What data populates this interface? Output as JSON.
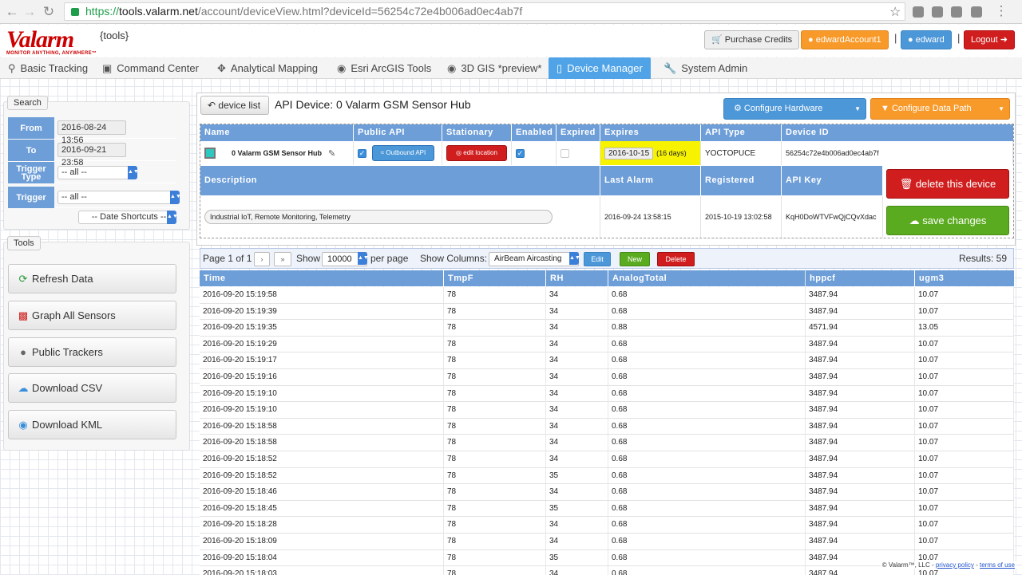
{
  "browser": {
    "url_scheme": "https://",
    "url_host": "tools.valarm.net",
    "url_path": "/account/deviceView.html?deviceId=56254c72e4b006ad0ec4ab7f"
  },
  "header": {
    "logo_text_red": "V",
    "logo_text_black": "alarm",
    "logo_tagline": "MONITOR ANYTHING, ANYWHERE™",
    "tools_label": "{tools}",
    "purchase_credits": "Purchase Credits",
    "account": "edwardAccount1",
    "user": "edward",
    "logout": "Logout",
    "sep": "|"
  },
  "tabs": [
    {
      "label": "Basic Tracking",
      "icon": "map-pin-icon"
    },
    {
      "label": "Command Center",
      "icon": "monitor-icon"
    },
    {
      "label": "Analytical Mapping",
      "icon": "crosshair-icon"
    },
    {
      "label": "Esri ArcGIS Tools",
      "icon": "globe-icon"
    },
    {
      "label": "3D GIS *preview*",
      "icon": "globe-icon"
    },
    {
      "label": "Device Manager",
      "icon": "tablet-icon"
    },
    {
      "label": "System Admin",
      "icon": "wrench-icon"
    }
  ],
  "search": {
    "legend": "Search",
    "from_label": "From",
    "from_value": "2016-08-24 13:56",
    "to_label": "To",
    "to_value": "2016-09-21 23:58",
    "trigger_type_label": "Trigger Type",
    "trigger_type_value": "-- all --",
    "trigger_label": "Trigger",
    "trigger_value": "-- all --",
    "date_shortcuts": "-- Date Shortcuts --"
  },
  "tools": {
    "legend": "Tools",
    "refresh": "Refresh Data",
    "graph": "Graph All Sensors",
    "trackers": "Public Trackers",
    "csv": "Download CSV",
    "kml": "Download KML"
  },
  "device": {
    "back_label": "device list",
    "title": "API Device: 0 Valarm GSM Sensor Hub",
    "configure_hardware": "Configure Hardware",
    "configure_data_path": "Configure Data Path",
    "headers": [
      "Name",
      "Public API",
      "Stationary",
      "Enabled",
      "Expired",
      "Expires",
      "API Type",
      "Device ID"
    ],
    "name": "0 Valarm GSM Sensor Hub",
    "outbound_api": "Outbound API",
    "edit_location": "edit location",
    "expires_date": "2016-10-15",
    "expires_days": "(16 days)",
    "api_type": "YOCTOPUCE",
    "device_id": "56254c72e4b006ad0ec4ab7f",
    "headers2": [
      "Description",
      "Last Alarm",
      "Registered",
      "API Key"
    ],
    "description": "Industrial IoT, Remote Monitoring, Telemetry",
    "last_alarm": "2016-09-24 13:58:15",
    "registered": "2015-10-19 13:02:58",
    "api_key": "KqH0DoWTVFwQjCQvXdac",
    "delete_label": "delete this device",
    "save_label": "save changes"
  },
  "pager": {
    "page_text": "Page 1 of 1",
    "next": "›",
    "last": "»",
    "show_label": "Show",
    "show_value": "10000",
    "per_page": "per page",
    "show_columns": "Show Columns:",
    "columns_value": "AirBeam Aircasting",
    "edit": "Edit",
    "new": "New",
    "delete": "Delete",
    "results": "Results: 59"
  },
  "grid": {
    "headers": [
      "Time",
      "TmpF",
      "RH",
      "AnalogTotal",
      "hppcf",
      "ugm3"
    ],
    "rows": [
      [
        "2016-09-20 15:19:58",
        "78",
        "34",
        "0.68",
        "3487.94",
        "10.07"
      ],
      [
        "2016-09-20 15:19:39",
        "78",
        "34",
        "0.68",
        "3487.94",
        "10.07"
      ],
      [
        "2016-09-20 15:19:35",
        "78",
        "34",
        "0.88",
        "4571.94",
        "13.05"
      ],
      [
        "2016-09-20 15:19:29",
        "78",
        "34",
        "0.68",
        "3487.94",
        "10.07"
      ],
      [
        "2016-09-20 15:19:17",
        "78",
        "34",
        "0.68",
        "3487.94",
        "10.07"
      ],
      [
        "2016-09-20 15:19:16",
        "78",
        "34",
        "0.68",
        "3487.94",
        "10.07"
      ],
      [
        "2016-09-20 15:19:10",
        "78",
        "34",
        "0.68",
        "3487.94",
        "10.07"
      ],
      [
        "2016-09-20 15:19:10",
        "78",
        "34",
        "0.68",
        "3487.94",
        "10.07"
      ],
      [
        "2016-09-20 15:18:58",
        "78",
        "34",
        "0.68",
        "3487.94",
        "10.07"
      ],
      [
        "2016-09-20 15:18:58",
        "78",
        "34",
        "0.68",
        "3487.94",
        "10.07"
      ],
      [
        "2016-09-20 15:18:52",
        "78",
        "34",
        "0.68",
        "3487.94",
        "10.07"
      ],
      [
        "2016-09-20 15:18:52",
        "78",
        "35",
        "0.68",
        "3487.94",
        "10.07"
      ],
      [
        "2016-09-20 15:18:46",
        "78",
        "34",
        "0.68",
        "3487.94",
        "10.07"
      ],
      [
        "2016-09-20 15:18:45",
        "78",
        "35",
        "0.68",
        "3487.94",
        "10.07"
      ],
      [
        "2016-09-20 15:18:28",
        "78",
        "34",
        "0.68",
        "3487.94",
        "10.07"
      ],
      [
        "2016-09-20 15:18:09",
        "78",
        "34",
        "0.68",
        "3487.94",
        "10.07"
      ],
      [
        "2016-09-20 15:18:04",
        "78",
        "35",
        "0.68",
        "3487.94",
        "10.07"
      ],
      [
        "2016-09-20 15:18:03",
        "78",
        "34",
        "0.68",
        "3487.94",
        "10.07"
      ]
    ]
  },
  "footer": {
    "copyright": "© Valarm™, LLC - ",
    "privacy": "privacy policy",
    "dash": " - ",
    "terms": "terms of use"
  }
}
